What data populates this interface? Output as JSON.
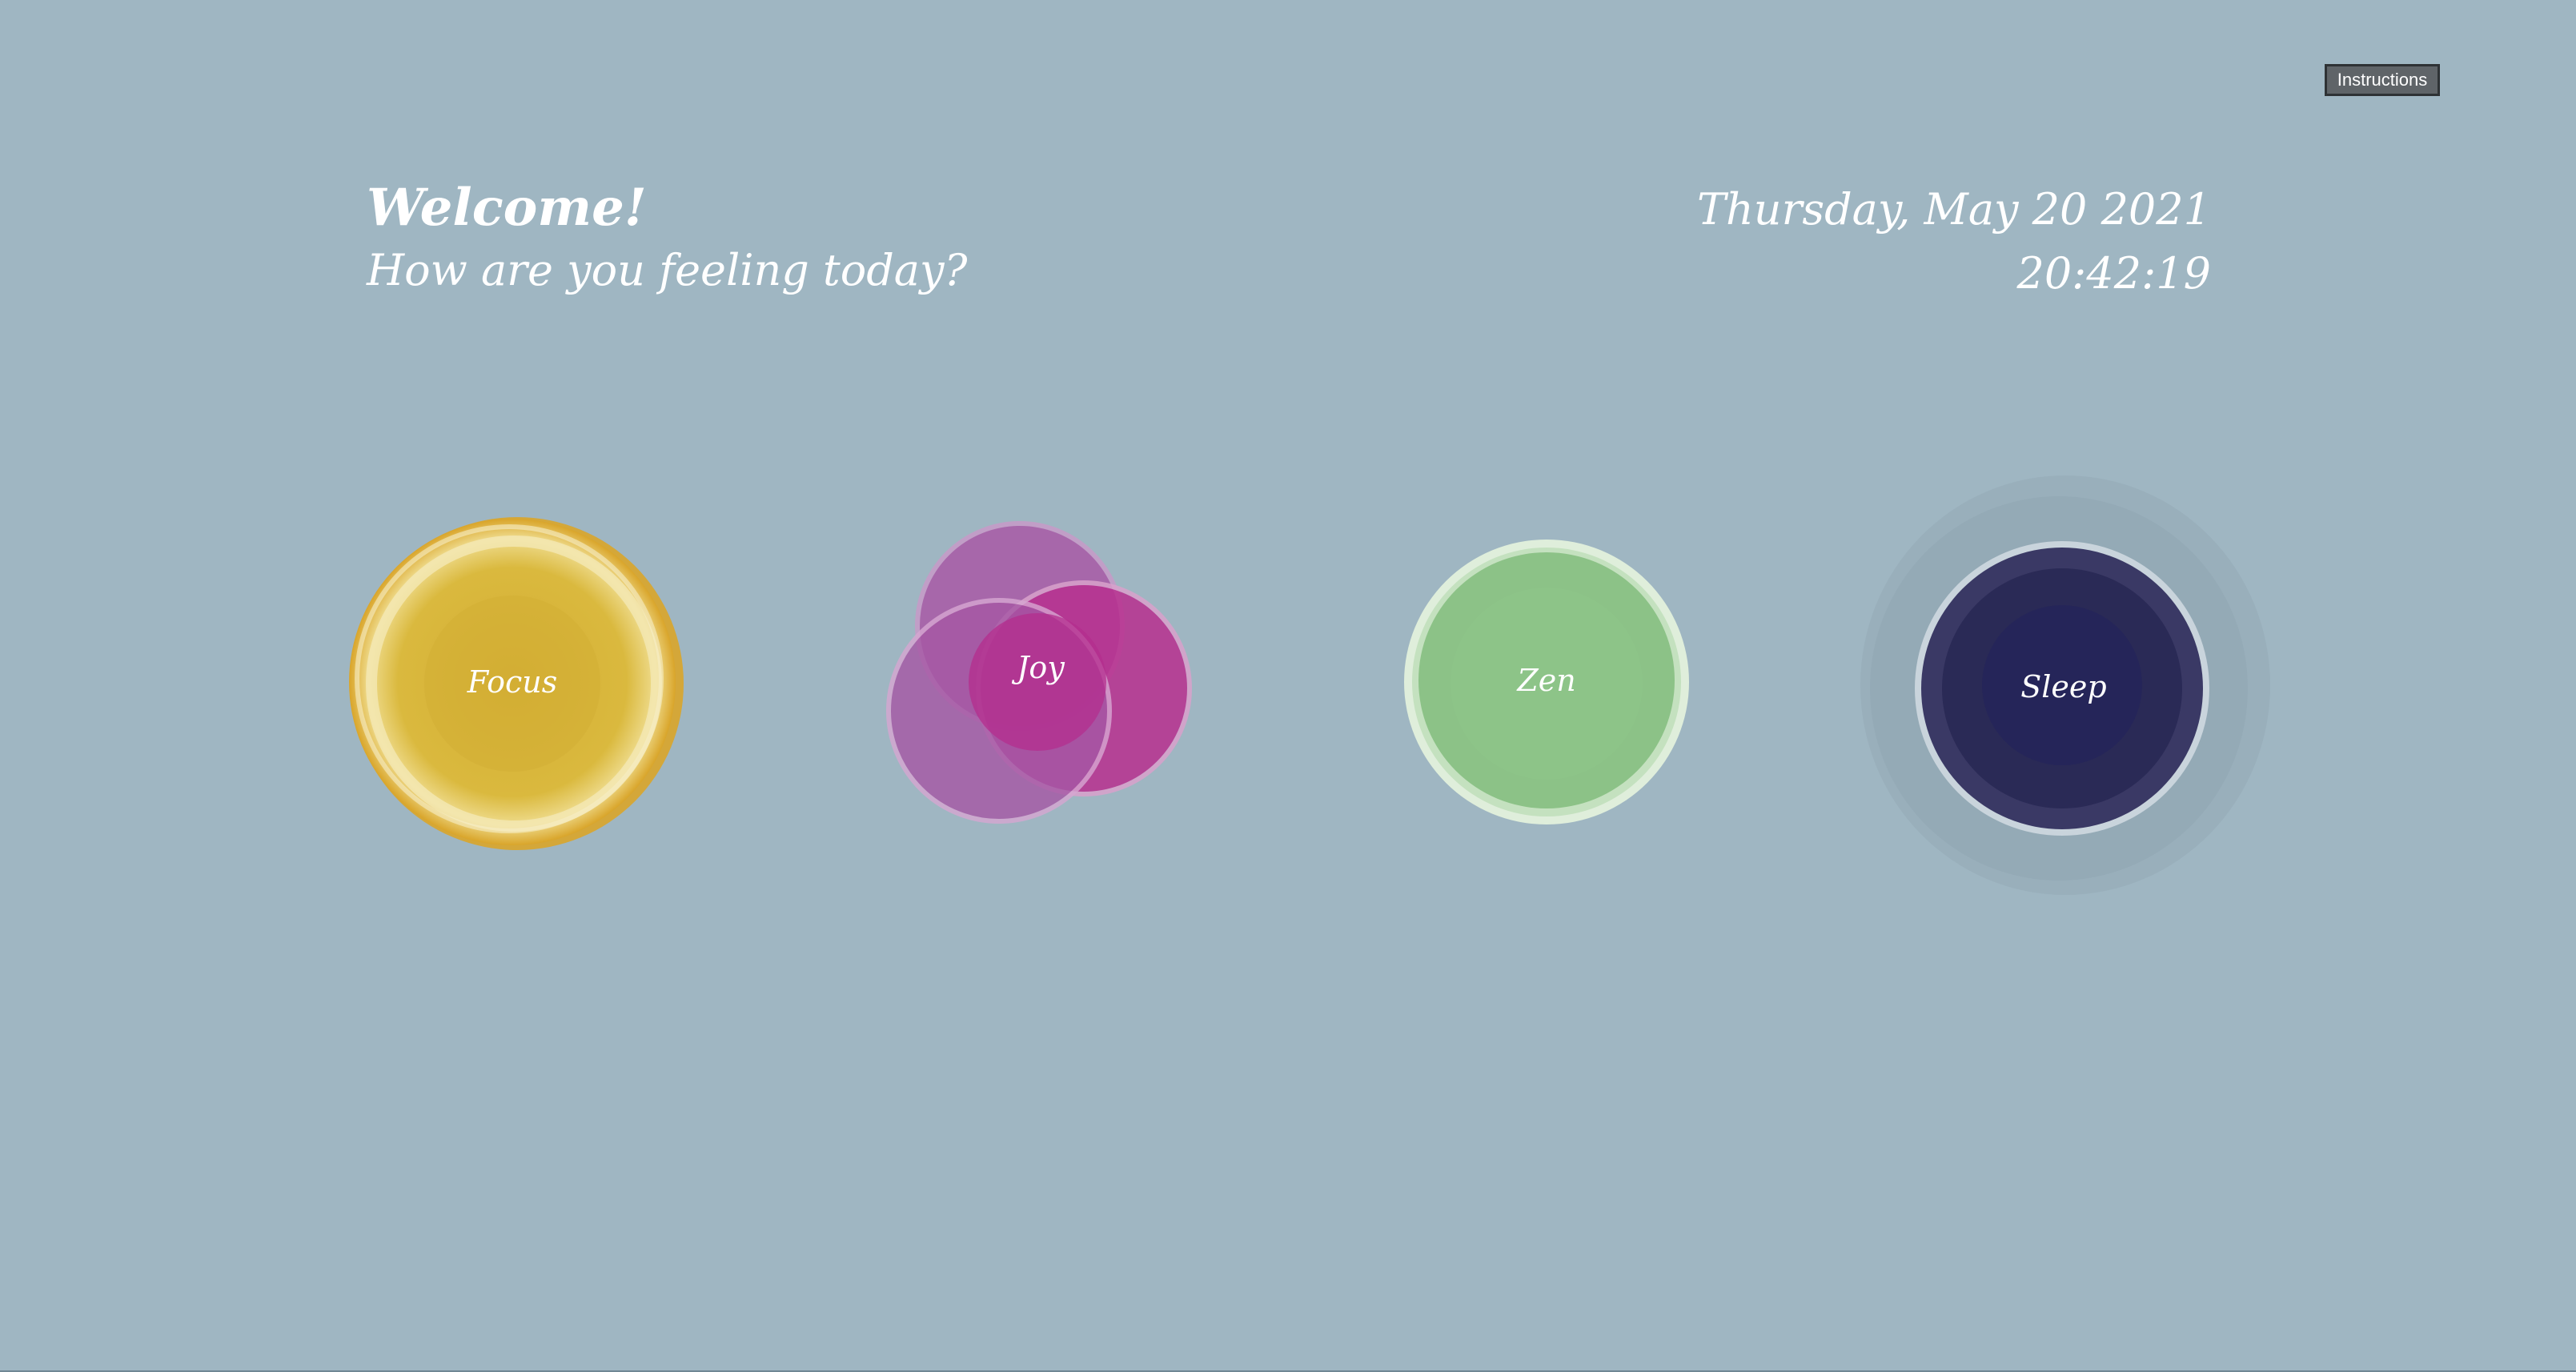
{
  "toolbar": {
    "instructions_label": "Instructions"
  },
  "greeting": {
    "title": "Welcome!",
    "subtitle": "How are you feeling today?"
  },
  "clock": {
    "date": "Thursday, May 20 2021",
    "time": "20:42:19"
  },
  "moods": [
    {
      "label": "Focus",
      "color": "#d9b53a"
    },
    {
      "label": "Joy",
      "color": "#b8308f"
    },
    {
      "label": "Zen",
      "color": "#8cc287"
    },
    {
      "label": "Sleep",
      "color": "#2b2a55"
    }
  ],
  "colors": {
    "background": "#9fb6c2",
    "text": "#ffffff"
  }
}
